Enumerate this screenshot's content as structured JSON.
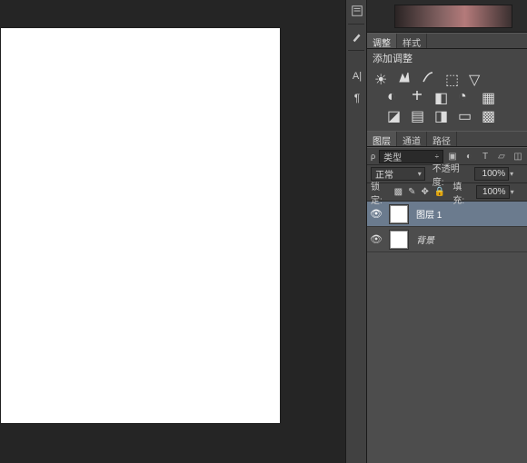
{
  "tabs": {
    "adjust": "调整",
    "style": "样式"
  },
  "adjustments": {
    "title": "添加调整"
  },
  "layers_tabs": {
    "layers": "图层",
    "channels": "通道",
    "paths": "路径"
  },
  "filter": {
    "label": "类型"
  },
  "blend": {
    "mode": "正常",
    "opacity_label": "不透明度:",
    "opacity": "100%"
  },
  "lock": {
    "label": "锁定:",
    "fill_label": "填充:",
    "fill": "100%"
  },
  "layers": [
    {
      "name": "图层 1",
      "italic": false
    },
    {
      "name": "背景",
      "italic": true
    }
  ]
}
